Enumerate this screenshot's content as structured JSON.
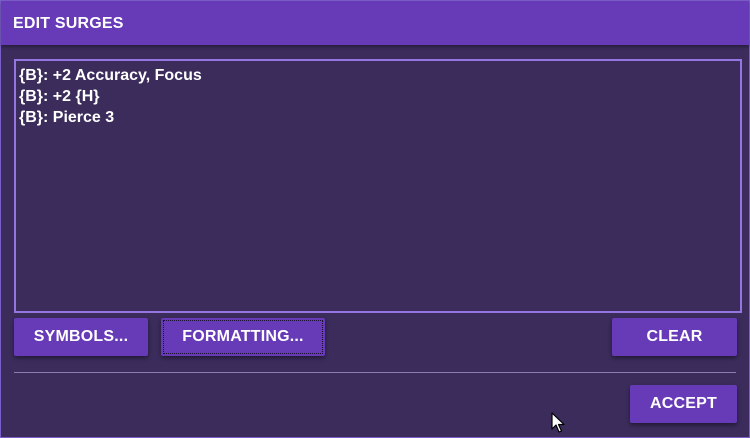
{
  "dialog": {
    "title": "EDIT SURGES",
    "editor_lines": [
      "{B}: +2 Accuracy, Focus",
      "{B}: +2 {H}",
      "{B}: Pierce 3"
    ],
    "buttons": {
      "symbols": "SYMBOLS...",
      "formatting": "FORMATTING...",
      "clear": "CLEAR",
      "accept": "ACCEPT"
    }
  },
  "colors": {
    "titlebar": "#673ab7",
    "background": "#3b2c5c",
    "editor_border": "#9575e0",
    "button": "#673ab7",
    "text": "#ffffff"
  },
  "icons": {
    "cursor": "mouse-pointer-icon"
  }
}
